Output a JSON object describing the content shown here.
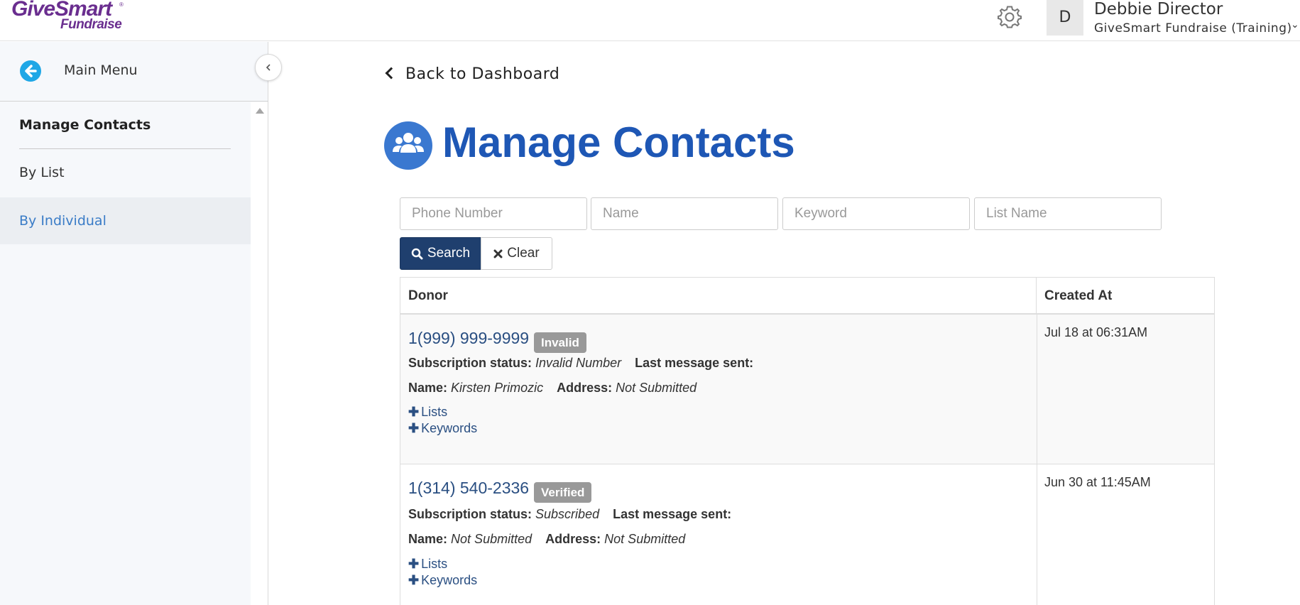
{
  "brand": {
    "line1": "GiveSmart",
    "line2": "Fundraise",
    "reg": "®"
  },
  "header": {
    "settings_icon": "gear-icon",
    "avatar_initial": "D",
    "user_name": "Debbie Director",
    "user_org": "GiveSmart Fundraise (Training)"
  },
  "sidebar": {
    "main_menu_label": "Main Menu",
    "section_title": "Manage Contacts",
    "items": [
      {
        "label": "By List",
        "active": false
      },
      {
        "label": "By Individual",
        "active": true
      }
    ]
  },
  "main": {
    "back_label": "Back to Dashboard",
    "title": "Manage Contacts",
    "filters": {
      "phone_placeholder": "Phone Number",
      "name_placeholder": "Name",
      "keyword_placeholder": "Keyword",
      "list_placeholder": "List Name"
    },
    "search_label": "Search",
    "clear_label": "Clear",
    "table": {
      "headers": {
        "donor": "Donor",
        "created_at": "Created At"
      },
      "subscription_label": "Subscription status:",
      "last_message_label": "Last message sent:",
      "name_label": "Name:",
      "address_label": "Address:",
      "lists_label": "Lists",
      "keywords_label": "Keywords",
      "rows": [
        {
          "phone": "1(999) 999-9999",
          "badge": "Invalid",
          "subscription": "Invalid Number",
          "last_message": "",
          "name": "Kirsten Primozic",
          "address": "Not Submitted",
          "created_at": "Jul 18 at 06:31AM"
        },
        {
          "phone": "1(314) 540-2336",
          "badge": "Verified",
          "subscription": "Subscribed",
          "last_message": "",
          "name": "Not Submitted",
          "address": "Not Submitted",
          "created_at": "Jun 30 at 11:45AM"
        }
      ]
    }
  },
  "colors": {
    "brand_purple": "#6a2e8f",
    "title_blue": "#1e57b5",
    "link_blue": "#2a4f82",
    "search_button": "#1f3f6e",
    "badge_gray": "#999999",
    "back_circle": "#1fa7e6"
  }
}
